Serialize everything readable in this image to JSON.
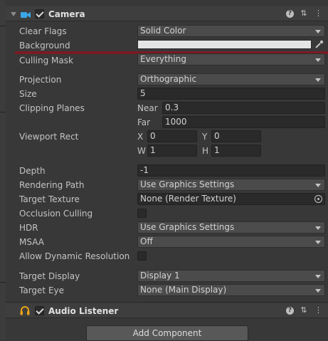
{
  "colors": {
    "panel_bg": "#383838",
    "header_bg": "#3e3e3e",
    "field_bg": "#2a2a2a",
    "dropdown_bg": "#4b4b4b",
    "accent_line": "#7a1b24",
    "background_swatch": "#e4e4e4",
    "listener_icon": "#e8a317",
    "camera_icon": "#3aa7e8"
  },
  "camera": {
    "title": "Camera",
    "icon": "camera-icon",
    "enabled": true,
    "header_icons": [
      "help-icon",
      "presets-icon",
      "more-icon"
    ],
    "fields": {
      "clear_flags": {
        "label": "Clear Flags",
        "value": "Solid Color"
      },
      "background": {
        "label": "Background"
      },
      "culling_mask": {
        "label": "Culling Mask",
        "value": "Everything"
      },
      "projection": {
        "label": "Projection",
        "value": "Orthographic"
      },
      "size": {
        "label": "Size",
        "value": "5"
      },
      "clipping_planes": {
        "label": "Clipping Planes",
        "near_label": "Near",
        "near": "0.3",
        "far_label": "Far",
        "far": "1000"
      },
      "viewport_rect": {
        "label": "Viewport Rect",
        "x_label": "X",
        "x": "0",
        "y_label": "Y",
        "y": "0",
        "w_label": "W",
        "w": "1",
        "h_label": "H",
        "h": "1"
      },
      "depth": {
        "label": "Depth",
        "value": "-1"
      },
      "rendering_path": {
        "label": "Rendering Path",
        "value": "Use Graphics Settings"
      },
      "target_texture": {
        "label": "Target Texture",
        "value": "None (Render Texture)"
      },
      "occlusion_culling": {
        "label": "Occlusion Culling",
        "checked": false
      },
      "hdr": {
        "label": "HDR",
        "value": "Use Graphics Settings"
      },
      "msaa": {
        "label": "MSAA",
        "value": "Off"
      },
      "dynamic_resolution": {
        "label": "Allow Dynamic Resolution",
        "checked": false
      },
      "target_display": {
        "label": "Target Display",
        "value": "Display 1"
      },
      "target_eye": {
        "label": "Target Eye",
        "value": "None (Main Display)"
      }
    }
  },
  "audio_listener": {
    "title": "Audio Listener",
    "icon": "headphones-icon",
    "enabled": true
  },
  "add_component": {
    "label": "Add Component"
  }
}
